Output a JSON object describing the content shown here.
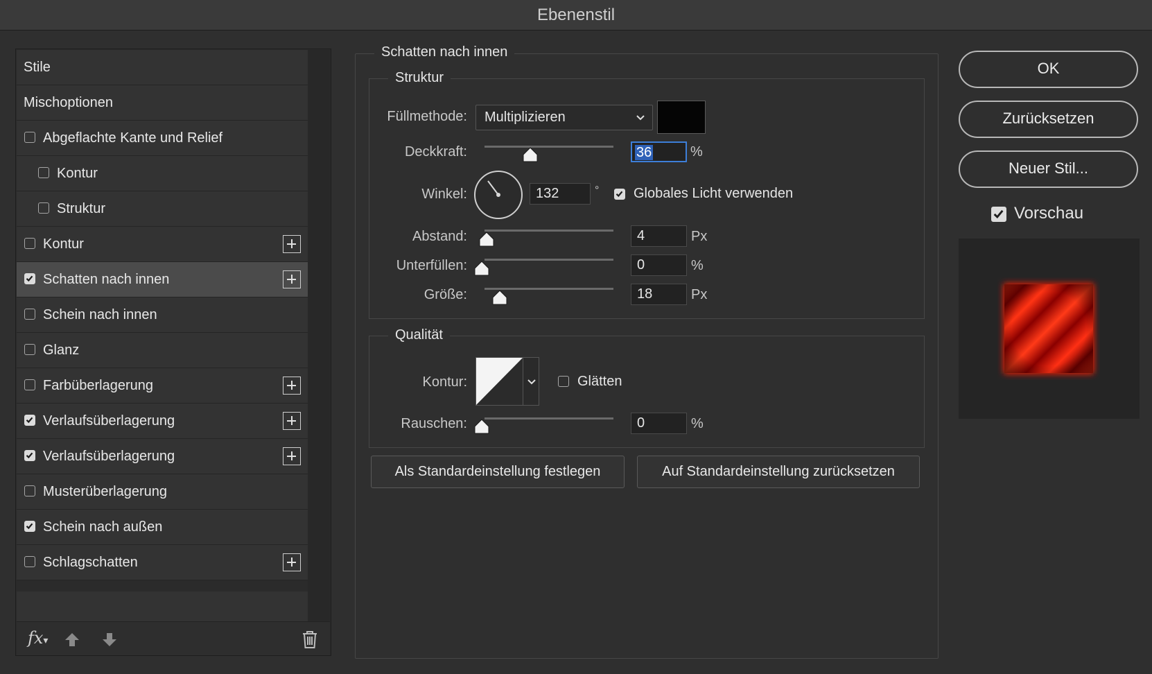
{
  "window": {
    "title": "Ebenenstil"
  },
  "style_list": {
    "items": [
      {
        "label": "Stile",
        "checkbox": false,
        "checked": false,
        "plus": false,
        "selected": false,
        "indent": 0
      },
      {
        "label": "Mischoptionen",
        "checkbox": false,
        "checked": false,
        "plus": false,
        "selected": false,
        "indent": 0
      },
      {
        "label": "Abgeflachte Kante und Relief",
        "checkbox": true,
        "checked": false,
        "plus": false,
        "selected": false,
        "indent": 0
      },
      {
        "label": "Kontur",
        "checkbox": true,
        "checked": false,
        "plus": false,
        "selected": false,
        "indent": 1
      },
      {
        "label": "Struktur",
        "checkbox": true,
        "checked": false,
        "plus": false,
        "selected": false,
        "indent": 1
      },
      {
        "label": "Kontur",
        "checkbox": true,
        "checked": false,
        "plus": true,
        "selected": false,
        "indent": 0
      },
      {
        "label": "Schatten nach innen",
        "checkbox": true,
        "checked": true,
        "plus": true,
        "selected": true,
        "indent": 0
      },
      {
        "label": "Schein nach innen",
        "checkbox": true,
        "checked": false,
        "plus": false,
        "selected": false,
        "indent": 0
      },
      {
        "label": "Glanz",
        "checkbox": true,
        "checked": false,
        "plus": false,
        "selected": false,
        "indent": 0
      },
      {
        "label": "Farbüberlagerung",
        "checkbox": true,
        "checked": false,
        "plus": true,
        "selected": false,
        "indent": 0
      },
      {
        "label": "Verlaufsüberlagerung",
        "checkbox": true,
        "checked": true,
        "plus": true,
        "selected": false,
        "indent": 0
      },
      {
        "label": "Verlaufsüberlagerung",
        "checkbox": true,
        "checked": true,
        "plus": true,
        "selected": false,
        "indent": 0
      },
      {
        "label": "Musterüberlagerung",
        "checkbox": true,
        "checked": false,
        "plus": false,
        "selected": false,
        "indent": 0
      },
      {
        "label": "Schein nach außen",
        "checkbox": true,
        "checked": true,
        "plus": false,
        "selected": false,
        "indent": 0
      },
      {
        "label": "Schlagschatten",
        "checkbox": true,
        "checked": false,
        "plus": true,
        "selected": false,
        "indent": 0
      }
    ],
    "bottom_icons": {
      "fx": "fx",
      "up": "arrow-up-icon",
      "down": "arrow-down-icon",
      "trash": "trash-icon"
    }
  },
  "inner_shadow": {
    "title": "Schatten nach innen",
    "structure": {
      "title": "Struktur",
      "blend_mode_label": "Füllmethode:",
      "blend_mode_value": "Multiplizieren",
      "shadow_color": "#050505",
      "opacity_label": "Deckkraft:",
      "opacity_value": "36",
      "opacity_unit": "%",
      "opacity_fraction": 0.36,
      "angle_label": "Winkel:",
      "angle_value": "132",
      "angle_unit": "°",
      "global_light_label": "Globales Licht verwenden",
      "global_light_checked": true,
      "distance_label": "Abstand:",
      "distance_value": "4",
      "distance_unit": "Px",
      "choke_label": "Unterfüllen:",
      "choke_value": "0",
      "choke_unit": "%",
      "size_label": "Größe:",
      "size_value": "18",
      "size_unit": "Px"
    },
    "quality": {
      "title": "Qualität",
      "contour_label": "Kontur:",
      "antialias_label": "Glätten",
      "antialias_checked": false,
      "noise_label": "Rauschen:",
      "noise_value": "0",
      "noise_unit": "%"
    },
    "make_default_label": "Als Standardeinstellung festlegen",
    "reset_default_label": "Auf Standardeinstellung zurücksetzen"
  },
  "actions": {
    "ok_label": "OK",
    "reset_label": "Zurücksetzen",
    "new_style_label": "Neuer Stil...",
    "preview_label": "Vorschau",
    "preview_checked": true
  }
}
